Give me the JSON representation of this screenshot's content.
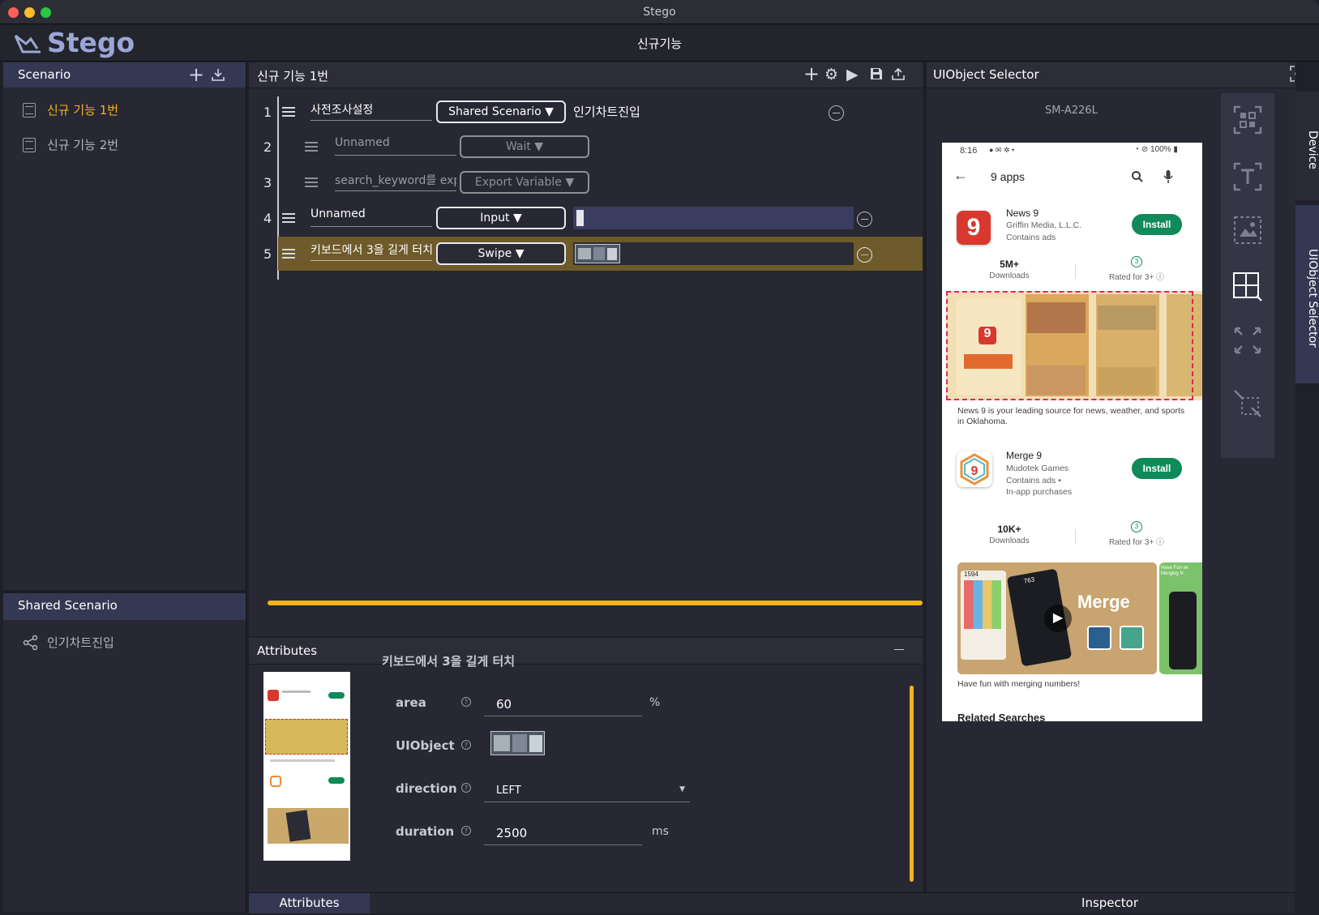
{
  "window": {
    "title": "Stego"
  },
  "app": {
    "logo": "Stego",
    "page_title": "신규기능"
  },
  "scenario_panel": {
    "title": "Scenario",
    "items": [
      {
        "label": "신규 기능 1번",
        "active": true
      },
      {
        "label": "신규 기능 2번",
        "active": false
      }
    ]
  },
  "shared_panel": {
    "title": "Shared Scenario",
    "items": [
      {
        "label": "인기차트진입"
      }
    ]
  },
  "editor": {
    "title": "신규 기능 1번",
    "steps": [
      {
        "num": "1",
        "name": "사전조사설정",
        "type": "Shared Scenario ▼",
        "value": "인기차트진입"
      },
      {
        "num": "2",
        "name": "Unnamed",
        "type": "Wait ▼"
      },
      {
        "num": "3",
        "name": "search_keyword를 expo",
        "type": "Export Variable ▼"
      },
      {
        "num": "4",
        "name": "Unnamed",
        "type": "Input ▼"
      },
      {
        "num": "5",
        "name": "키보드에서 3을 길게 터치",
        "type": "Swipe ▼"
      }
    ]
  },
  "attributes": {
    "title": "Attributes",
    "step_title": "키보드에서 3을 길게 터치",
    "help_glyph": "?",
    "fields": {
      "area": {
        "label": "area",
        "value": "60",
        "unit": "%"
      },
      "uiobject": {
        "label": "UIObject"
      },
      "direction": {
        "label": "direction",
        "value": "LEFT"
      },
      "duration": {
        "label": "duration",
        "value": "2500",
        "unit": "ms"
      }
    }
  },
  "bottom_tabs": {
    "attributes": "Attributes",
    "inspector": "Inspector"
  },
  "uiobject_selector": {
    "title": "UIObject Selector",
    "device": "SM-A226L"
  },
  "side_tabs": {
    "device": "Device",
    "uiobject_selector": "UIObject Selector"
  },
  "phone": {
    "status_time": "8:16",
    "battery": "100%",
    "search_query": "9 apps",
    "apps": [
      {
        "name": "News 9",
        "developer": "Griffin Media, L.L.C.",
        "tag1": "Contains ads",
        "install": "Install",
        "downloads": "5M+",
        "downloads_label": "Downloads",
        "rating_badge": "3",
        "rating_label": "Rated for 3+ ⓘ",
        "description": "News 9 is your leading source for news, weather, and sports in Oklahoma."
      },
      {
        "name": "Merge 9",
        "developer": "Mudotek Games",
        "tag1": "Contains ads  •",
        "tag2": "In-app purchases",
        "install": "Install",
        "downloads": "10K+",
        "downloads_label": "Downloads",
        "rating_badge": "3",
        "rating_label": "Rated for 3+ ⓘ",
        "description": "Have fun with merging numbers!"
      }
    ],
    "promo_title": "Merge",
    "promo_count_left": "1594",
    "promo_count_card": "763",
    "promo_badge": "Have Fun wi Merging N",
    "related": "Related Searches"
  },
  "colors": {
    "accent": "#f5b31c",
    "selected_row": "#6e5a2a",
    "install_green": "#0f8a58",
    "panel_header": "#353852"
  }
}
